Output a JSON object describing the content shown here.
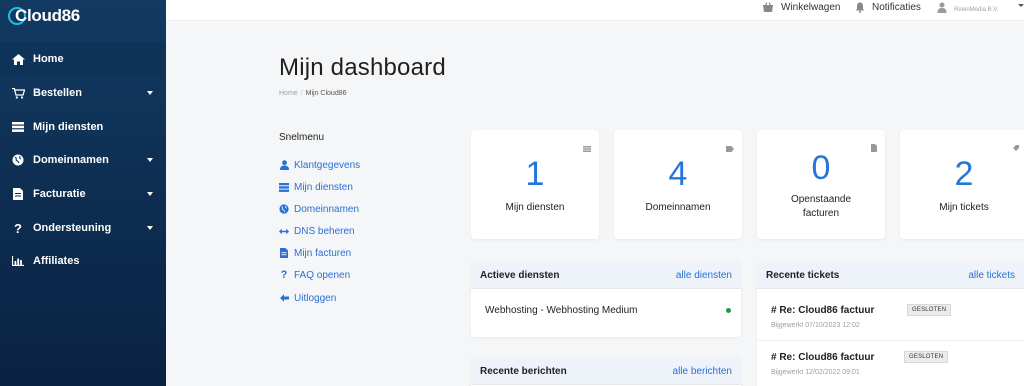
{
  "app": {
    "logo": "Cloud86"
  },
  "sidebar": {
    "items": [
      {
        "label": "Home",
        "icon": "home-icon",
        "active": true,
        "has_submenu": false
      },
      {
        "label": "Bestellen",
        "icon": "cart-icon",
        "active": false,
        "has_submenu": true
      },
      {
        "label": "Mijn diensten",
        "icon": "server-icon",
        "active": false,
        "has_submenu": false
      },
      {
        "label": "Domeinnamen",
        "icon": "globe-icon",
        "active": false,
        "has_submenu": true
      },
      {
        "label": "Facturatie",
        "icon": "document-icon",
        "active": false,
        "has_submenu": true
      },
      {
        "label": "Ondersteuning",
        "icon": "question-icon",
        "active": false,
        "has_submenu": true
      },
      {
        "label": "Affiliates",
        "icon": "chart-icon",
        "active": false,
        "has_submenu": false
      }
    ]
  },
  "topbar": {
    "cart_label": "Winkelwagen",
    "notifications_label": "Notificaties",
    "company": "RelenMedia B.V."
  },
  "page": {
    "title": "Mijn dashboard",
    "breadcrumb": {
      "home": "Home",
      "current": "Mijn Cloud86"
    }
  },
  "snelmenu": {
    "title": "Snelmenu",
    "items": [
      {
        "label": "Klantgegevens",
        "icon": "user-icon"
      },
      {
        "label": "Mijn diensten",
        "icon": "server-icon"
      },
      {
        "label": "Domeinnamen",
        "icon": "globe-icon"
      },
      {
        "label": "DNS beheren",
        "icon": "arrows-icon"
      },
      {
        "label": "Mijn facturen",
        "icon": "document-icon"
      },
      {
        "label": "FAQ openen",
        "icon": "question-icon"
      },
      {
        "label": "Uitloggen",
        "icon": "logout-icon"
      }
    ]
  },
  "stats": [
    {
      "value": "1",
      "label": "Mijn diensten",
      "icon": "server-icon"
    },
    {
      "value": "4",
      "label": "Domeinnamen",
      "icon": "tag-icon"
    },
    {
      "value": "0",
      "label_line1": "Openstaande",
      "label_line2": "facturen",
      "icon": "document-icon"
    },
    {
      "value": "2",
      "label": "Mijn tickets",
      "icon": "ticket-icon"
    }
  ],
  "active_services": {
    "title": "Actieve diensten",
    "link": "alle diensten",
    "items": [
      {
        "name": "Webhosting - Webhosting Medium",
        "status_color": "#1c9c3a"
      }
    ]
  },
  "recent_tickets": {
    "title": "Recente tickets",
    "link": "alle tickets",
    "items": [
      {
        "title": "# Re: Cloud86 factuur",
        "updated": "Bijgewerkt 07/10/2023 12:02",
        "status": "GESLOTEN"
      },
      {
        "title": "# Re: Cloud86 factuur",
        "updated": "Bijgewerkt 12/02/2022 09:01",
        "status": "GESLOTEN"
      }
    ]
  },
  "recent_messages": {
    "title": "Recente berichten",
    "link": "alle berichten"
  },
  "colors": {
    "accent": "#2676d9",
    "link": "#2b6fd6",
    "sidebar": "#0e2f53",
    "status_active": "#1c9c3a"
  }
}
